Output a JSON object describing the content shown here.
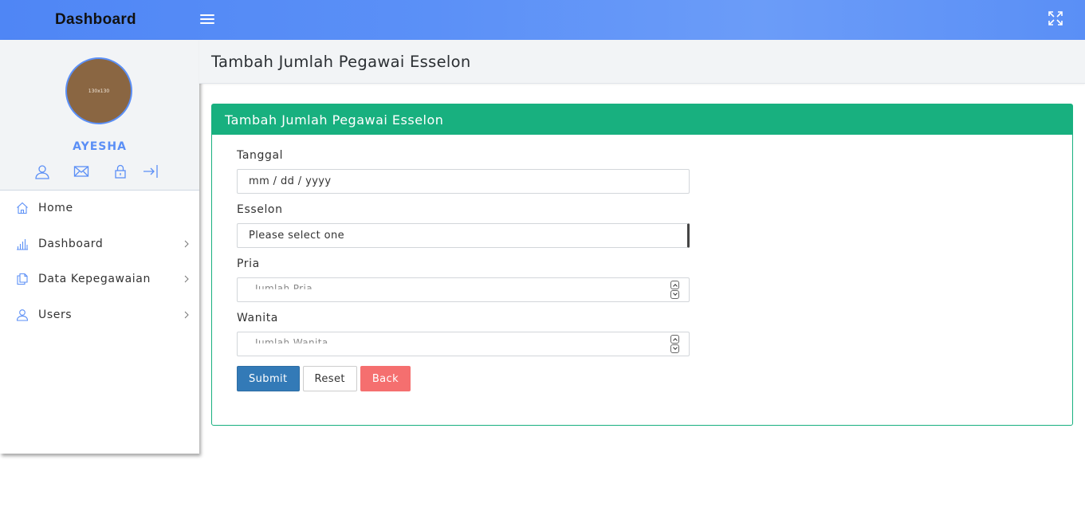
{
  "topbar": {
    "brand": "Dashboard",
    "menu_icon": "hamburger-icon",
    "expand_icon": "fullscreen-icon",
    "color": "#5b90f7"
  },
  "sidebar": {
    "avatar_text": "130x130",
    "username": "AYESHA",
    "profile_icons": [
      "user-icon",
      "mail-icon",
      "lock-icon",
      "logout-icon"
    ],
    "menu": [
      {
        "label": "Home",
        "icon": "home-icon",
        "has_children": false
      },
      {
        "label": "Dashboard",
        "icon": "bar-chart-icon",
        "has_children": true
      },
      {
        "label": "Data Kepegawaian",
        "icon": "documents-icon",
        "has_children": true
      },
      {
        "label": "Users",
        "icon": "user-icon",
        "has_children": true
      }
    ]
  },
  "header": {
    "title": "Tambah Jumlah Pegawai Esselon"
  },
  "panel": {
    "title": "Tambah Jumlah Pegawai Esselon",
    "accent": "#18b07f",
    "fields": {
      "tanggal": {
        "label": "Tanggal",
        "placeholder": "mm / dd / yyyy"
      },
      "esselon": {
        "label": "Esselon",
        "selected": "Please select one"
      },
      "pria": {
        "label": "Pria",
        "placeholder": "Jumlah Pria"
      },
      "wanita": {
        "label": "Wanita",
        "placeholder": "Jumlah Wanita"
      }
    },
    "buttons": {
      "submit": "Submit",
      "reset": "Reset",
      "back": "Back"
    }
  }
}
